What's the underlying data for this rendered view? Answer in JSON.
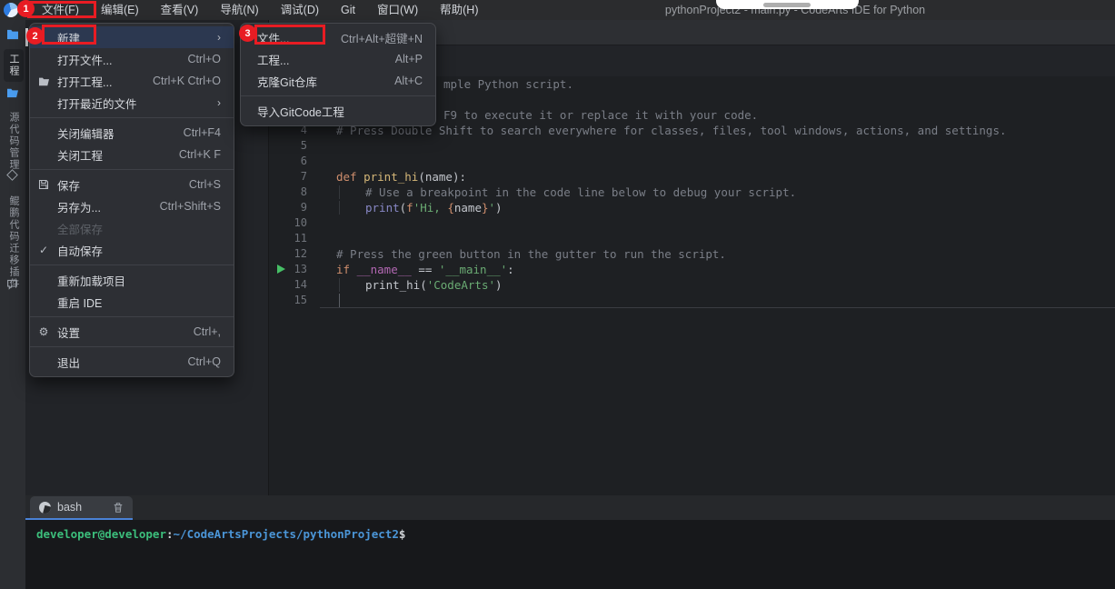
{
  "window": {
    "title": "pythonProject2 - main.py - CodeArts IDE for Python"
  },
  "menubar": {
    "items": [
      {
        "label": "文件(F)"
      },
      {
        "label": "编辑(E)"
      },
      {
        "label": "查看(V)"
      },
      {
        "label": "导航(N)"
      },
      {
        "label": "调试(D)"
      },
      {
        "label": "Git"
      },
      {
        "label": "窗口(W)"
      },
      {
        "label": "帮助(H)"
      }
    ]
  },
  "annotations": {
    "step1": "1",
    "step2": "2",
    "step3": "3"
  },
  "activity_bar": {
    "items": [
      {
        "icon": "folder",
        "label": "工程",
        "active": true
      },
      {
        "icon": "folder-open",
        "label": "源代码管理"
      },
      {
        "icon": "diamond",
        "label": "鲲鹏代码迁移插件"
      }
    ]
  },
  "file_menu": {
    "items": [
      {
        "type": "item",
        "label": "新建",
        "submenu": true,
        "highlighted": true
      },
      {
        "type": "item",
        "label": "打开文件...",
        "shortcut": "Ctrl+O"
      },
      {
        "type": "item",
        "label": "打开工程...",
        "shortcut": "Ctrl+K Ctrl+O",
        "icon": "folder-open"
      },
      {
        "type": "item",
        "label": "打开最近的文件",
        "submenu": true
      },
      {
        "type": "sep"
      },
      {
        "type": "item",
        "label": "关闭编辑器",
        "shortcut": "Ctrl+F4"
      },
      {
        "type": "item",
        "label": "关闭工程",
        "shortcut": "Ctrl+K F"
      },
      {
        "type": "sep"
      },
      {
        "type": "item",
        "label": "保存",
        "shortcut": "Ctrl+S",
        "icon": "save"
      },
      {
        "type": "item",
        "label": "另存为...",
        "shortcut": "Ctrl+Shift+S"
      },
      {
        "type": "item",
        "label": "全部保存",
        "disabled": true
      },
      {
        "type": "item",
        "label": "自动保存",
        "icon": "check"
      },
      {
        "type": "sep"
      },
      {
        "type": "item",
        "label": "重新加载项目"
      },
      {
        "type": "item",
        "label": "重启 IDE"
      },
      {
        "type": "sep"
      },
      {
        "type": "item",
        "label": "设置",
        "shortcut": "Ctrl+,",
        "icon": "gear"
      },
      {
        "type": "sep"
      },
      {
        "type": "item",
        "label": "退出",
        "shortcut": "Ctrl+Q"
      }
    ]
  },
  "new_submenu": {
    "items": [
      {
        "type": "item",
        "label": "文件...",
        "shortcut": "Ctrl+Alt+超键+N"
      },
      {
        "type": "item",
        "label": "工程...",
        "shortcut": "Alt+P"
      },
      {
        "type": "item",
        "label": "克隆Git仓库",
        "shortcut": "Alt+C"
      },
      {
        "type": "sep"
      },
      {
        "type": "item",
        "label": "导入GitCode工程"
      }
    ]
  },
  "editor": {
    "lines": [
      {
        "num": "",
        "partial": true,
        "tokens": [
          {
            "c": "comment",
            "t": "mple Python script."
          }
        ]
      },
      {
        "num": "",
        "tokens": []
      },
      {
        "num": "",
        "partial": true,
        "tokens": [
          {
            "c": "comment",
            "t": "F9 to execute it or replace it with your code."
          }
        ]
      },
      {
        "num": "4",
        "tokens": [
          {
            "c": "comment",
            "t": "# Press Double Shift to search everywhere for classes, files, tool windows, actions, and settings."
          }
        ]
      },
      {
        "num": "5",
        "tokens": []
      },
      {
        "num": "6",
        "tokens": []
      },
      {
        "num": "7",
        "tokens": [
          {
            "c": "kw",
            "t": "def "
          },
          {
            "c": "fn",
            "t": "print_hi"
          },
          {
            "c": "plain",
            "t": "(name):"
          }
        ]
      },
      {
        "num": "8",
        "indent": 1,
        "tokens": [
          {
            "c": "comment",
            "t": "# Use a breakpoint in the code line below to debug your script."
          }
        ]
      },
      {
        "num": "9",
        "indent": 1,
        "tokens": [
          {
            "c": "builtin",
            "t": "print"
          },
          {
            "c": "plain",
            "t": "("
          },
          {
            "c": "kw",
            "t": "f"
          },
          {
            "c": "str",
            "t": "'Hi, "
          },
          {
            "c": "brace",
            "t": "{"
          },
          {
            "c": "plain",
            "t": "name"
          },
          {
            "c": "brace",
            "t": "}"
          },
          {
            "c": "str",
            "t": "'"
          },
          {
            "c": "plain",
            "t": ")"
          }
        ]
      },
      {
        "num": "10",
        "tokens": []
      },
      {
        "num": "11",
        "tokens": []
      },
      {
        "num": "12",
        "tokens": [
          {
            "c": "comment",
            "t": "# Press the green button in the gutter to run the script."
          }
        ]
      },
      {
        "num": "13",
        "run": true,
        "tokens": [
          {
            "c": "kw",
            "t": "if "
          },
          {
            "c": "dunder",
            "t": "__name__"
          },
          {
            "c": "plain",
            "t": " == "
          },
          {
            "c": "str",
            "t": "'__main__'"
          },
          {
            "c": "plain",
            "t": ":"
          }
        ]
      },
      {
        "num": "14",
        "indent": 1,
        "tokens": [
          {
            "c": "plain",
            "t": "print_hi("
          },
          {
            "c": "str",
            "t": "'CodeArts'"
          },
          {
            "c": "plain",
            "t": ")"
          }
        ]
      },
      {
        "num": "15",
        "caret": true,
        "tokens": []
      }
    ]
  },
  "terminal": {
    "tab_label": "bash",
    "prompt": {
      "user": "developer@developer",
      "colon": ":",
      "path": "~/CodeArtsProjects/pythonProject2",
      "dollar": "$"
    }
  },
  "colors": {
    "annotation_red": "#e81c23",
    "run_green": "#46bf66",
    "tab_underline": "#4a82d6",
    "prompt_green": "#3cbf7c",
    "prompt_blue": "#4b96d8",
    "menu_highlight": "#2c3850"
  }
}
